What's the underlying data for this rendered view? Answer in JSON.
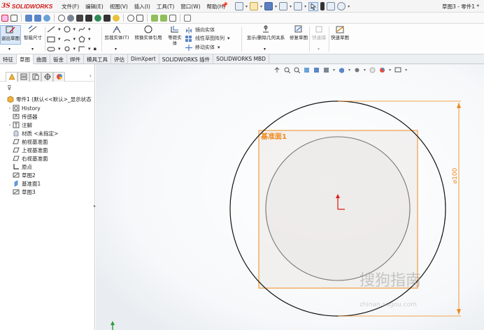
{
  "app": {
    "logo_ds": "3S",
    "logo_brand": "SOLIDWORKS",
    "menu": [
      "文件(F)",
      "编辑(E)",
      "视图(V)",
      "插入(I)",
      "工具(T)",
      "窗口(W)",
      "帮助(H)"
    ],
    "title": "草图3 - 零件1 *"
  },
  "commands": {
    "exit_sketch": "退出草图",
    "smart_dim": "智能尺寸",
    "trim": "剪裁实体(T)",
    "convert": "转换实体引用",
    "offset": "等距实体",
    "mirror": "镜向实体",
    "linear_pattern": "线性草图阵列",
    "move": "移动实体",
    "relations": "显示/删除几何关系",
    "repair": "修复草图",
    "quick_snap": "快速捕",
    "rapid_sketch": "快速草图"
  },
  "tabs": [
    "特征",
    "草图",
    "曲面",
    "钣金",
    "焊件",
    "模具工具",
    "评估",
    "DimXpert",
    "SOLIDWORKS 插件",
    "SOLIDWORKS MBD"
  ],
  "active_tab": 1,
  "tree": {
    "root": "零件1  (默认<<默认>_显示状态",
    "items": [
      "History",
      "传感器",
      "注解",
      "材质 <未指定>",
      "前视基准面",
      "上视基准面",
      "右视基准面",
      "原点",
      "草图2",
      "基准面1",
      "草图3"
    ]
  },
  "graphics": {
    "plane_label": "基准面1",
    "dimension_label": "⌀100",
    "watermark": "搜狗指南",
    "watermark_url": "zhinan.sogou.com",
    "accent_orange": "#f08a1c",
    "origin_red": "#e02020"
  }
}
